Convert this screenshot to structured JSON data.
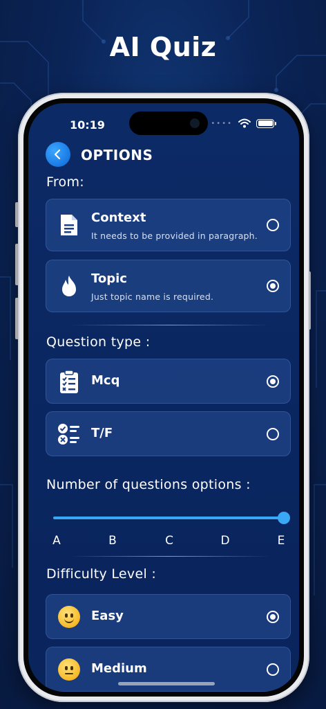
{
  "app_title": "AI Quiz",
  "status": {
    "time": "10:19"
  },
  "header": {
    "title": "OPTIONS"
  },
  "from": {
    "label": "From:",
    "options": [
      {
        "title": "Context",
        "subtitle": "It needs to be provided in paragraph.",
        "icon": "document-icon",
        "selected": false
      },
      {
        "title": "Topic",
        "subtitle": "Just topic name is required.",
        "icon": "flame-icon",
        "selected": true
      }
    ]
  },
  "question_type": {
    "label": "Question type :",
    "options": [
      {
        "title": "Mcq",
        "icon": "clipboard-checklist-icon",
        "selected": true
      },
      {
        "title": "T/F",
        "icon": "true-false-icon",
        "selected": false
      }
    ]
  },
  "num_options": {
    "label": "Number of questions options :",
    "ticks": [
      "A",
      "B",
      "C",
      "D",
      "E"
    ],
    "selected": "E"
  },
  "difficulty": {
    "label": "Difficulty Level :",
    "options": [
      {
        "title": "Easy",
        "icon": "slightly-smiling-face-icon",
        "selected": true
      },
      {
        "title": "Medium",
        "icon": "neutral-face-icon",
        "selected": false
      }
    ]
  },
  "colors": {
    "accent": "#3aa8f5",
    "background": "#0b2559",
    "card": "#284e96"
  }
}
